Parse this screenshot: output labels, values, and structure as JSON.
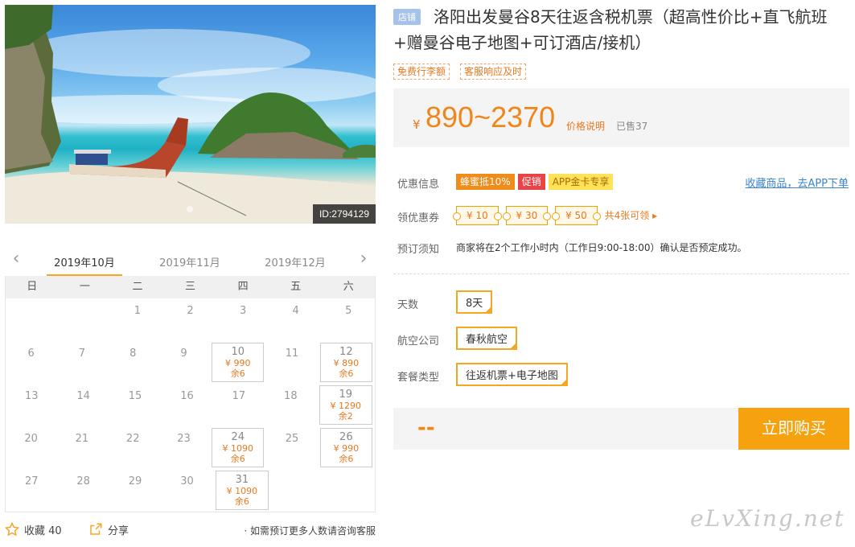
{
  "product": {
    "shop_badge": "店铺",
    "title": "洛阳出发曼谷8天往返含税机票（超高性价比+直飞航班+赠曼谷电子地图+可订酒店/接机）",
    "tags": [
      "免费行李额",
      "客服响应及时"
    ],
    "image_id": "ID:2794129"
  },
  "price": {
    "currency": "¥",
    "range": "890~2370",
    "explain": "价格说明",
    "sold": "已售37"
  },
  "promo": {
    "label": "优惠信息",
    "chips": [
      "蜂蜜抵10%",
      "促销",
      "APP金卡专享"
    ],
    "fav_link": "收藏商品，去APP下单"
  },
  "coupon": {
    "label": "领优惠券",
    "items": [
      "¥ 10",
      "¥ 30",
      "¥ 50"
    ],
    "more": "共4张可领 ▸"
  },
  "notice": {
    "label": "预订须知",
    "text": "商家将在2个工作小时内（工作日9:00-18:00）确认是否预定成功。"
  },
  "options": {
    "days_label": "天数",
    "days_value": "8天",
    "airline_label": "航空公司",
    "airline_value": "春秋航空",
    "package_label": "套餐类型",
    "package_value": "往返机票+电子地图"
  },
  "buy": {
    "price_placeholder": "--",
    "button": "立即购买"
  },
  "calendar": {
    "months": [
      "2019年10月",
      "2019年11月",
      "2019年12月"
    ],
    "active_month": 0,
    "weekdays": [
      "日",
      "一",
      "二",
      "三",
      "四",
      "五",
      "六"
    ],
    "rows": [
      [
        {
          "d": ""
        },
        {
          "d": ""
        },
        {
          "d": "1"
        },
        {
          "d": "2"
        },
        {
          "d": "3"
        },
        {
          "d": "4"
        },
        {
          "d": "5"
        }
      ],
      [
        {
          "d": "6"
        },
        {
          "d": "7"
        },
        {
          "d": "8"
        },
        {
          "d": "9"
        },
        {
          "d": "10",
          "p": "¥ 990",
          "s": "余6"
        },
        {
          "d": "11"
        },
        {
          "d": "12",
          "p": "¥ 890",
          "s": "余6"
        }
      ],
      [
        {
          "d": "13"
        },
        {
          "d": "14"
        },
        {
          "d": "15"
        },
        {
          "d": "16"
        },
        {
          "d": "17"
        },
        {
          "d": "18"
        },
        {
          "d": "19",
          "p": "¥ 1290",
          "s": "余2"
        }
      ],
      [
        {
          "d": "20"
        },
        {
          "d": "21"
        },
        {
          "d": "22"
        },
        {
          "d": "23"
        },
        {
          "d": "24",
          "p": "¥ 1090",
          "s": "余6"
        },
        {
          "d": "25"
        },
        {
          "d": "26",
          "p": "¥ 990",
          "s": "余6"
        }
      ],
      [
        {
          "d": "27"
        },
        {
          "d": "28"
        },
        {
          "d": "29"
        },
        {
          "d": "30"
        },
        {
          "d": "31",
          "p": "¥ 1090",
          "s": "余6"
        },
        {
          "d": ""
        },
        {
          "d": ""
        }
      ]
    ]
  },
  "actions": {
    "favorite": "收藏 40",
    "share": "分享",
    "note": "· 如需预订更多人数请咨询客服"
  },
  "watermark": "eLvXing.net",
  "colors": {
    "accent": "#f5a623",
    "price": "#f08519",
    "link": "#3d84c9"
  }
}
